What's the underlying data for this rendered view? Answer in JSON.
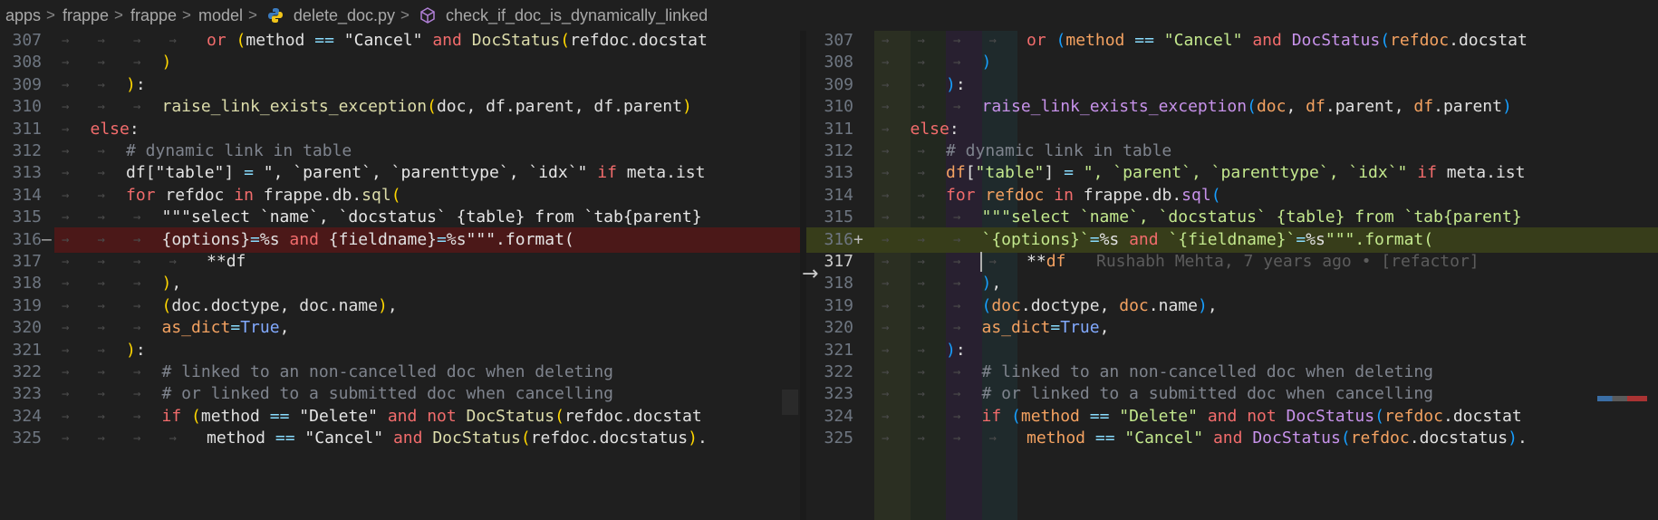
{
  "breadcrumb": {
    "items": [
      "apps",
      "frappe",
      "frappe",
      "model",
      "delete_doc.py",
      "check_if_doc_is_dynamically_linked"
    ],
    "separator": ">"
  },
  "editor": {
    "active_line": 317,
    "lines": [
      {
        "n": "307",
        "indent": 4,
        "html": "or (method == \"Cancel\" and DocStatus(refdoc.docstat"
      },
      {
        "n": "308",
        "indent": 3,
        "html": ")"
      },
      {
        "n": "309",
        "indent": 2,
        "html": "):"
      },
      {
        "n": "310",
        "indent": 3,
        "html": "raise_link_exists_exception(doc, df.parent, df.parent)"
      },
      {
        "n": "311",
        "indent": 1,
        "html": "else:"
      },
      {
        "n": "312",
        "indent": 2,
        "html": "# dynamic link in table"
      },
      {
        "n": "313",
        "indent": 2,
        "html": "df[\"table\"] = \", `parent`, `parenttype`, `idx`\" if meta.ist"
      },
      {
        "n": "314",
        "indent": 2,
        "html": "for refdoc in frappe.db.sql("
      },
      {
        "n": "315",
        "indent": 3,
        "html": "\"\"\"select `name`, `docstatus` {table} from `tab{parent}"
      },
      {
        "n": "316",
        "indent": 3,
        "html": "{options}=%s and {fieldname}=%s\"\"\".format("
      },
      {
        "n": "317",
        "indent": 4,
        "html": "**df"
      },
      {
        "n": "318",
        "indent": 3,
        "html": "),"
      },
      {
        "n": "319",
        "indent": 3,
        "html": "(doc.doctype, doc.name),"
      },
      {
        "n": "320",
        "indent": 3,
        "html": "as_dict=True,"
      },
      {
        "n": "321",
        "indent": 2,
        "html": "):"
      },
      {
        "n": "322",
        "indent": 3,
        "html": "# linked to an non-cancelled doc when deleting"
      },
      {
        "n": "323",
        "indent": 3,
        "html": "# or linked to a submitted doc when cancelling"
      },
      {
        "n": "324",
        "indent": 3,
        "html": "if (method == \"Delete\" and not DocStatus(refdoc.docstat"
      },
      {
        "n": "325",
        "indent": 4,
        "html": "method == \"Cancel\" and DocStatus(refdoc.docstatus)."
      }
    ],
    "right_line_316": "`{options}`=%s and `{fieldname}`=%s\"\"\".format(",
    "blame": "Rushabh Mehta, 7 years ago • [refactor]",
    "deleted_marker": "—",
    "added_marker": "+",
    "arrow": "→"
  },
  "colors": {
    "deleted_bg": "#4b1818",
    "added_bg": "#373d1a",
    "keyword": "#f26c6c",
    "function": "#c792ea",
    "string": "#c3e88d"
  }
}
